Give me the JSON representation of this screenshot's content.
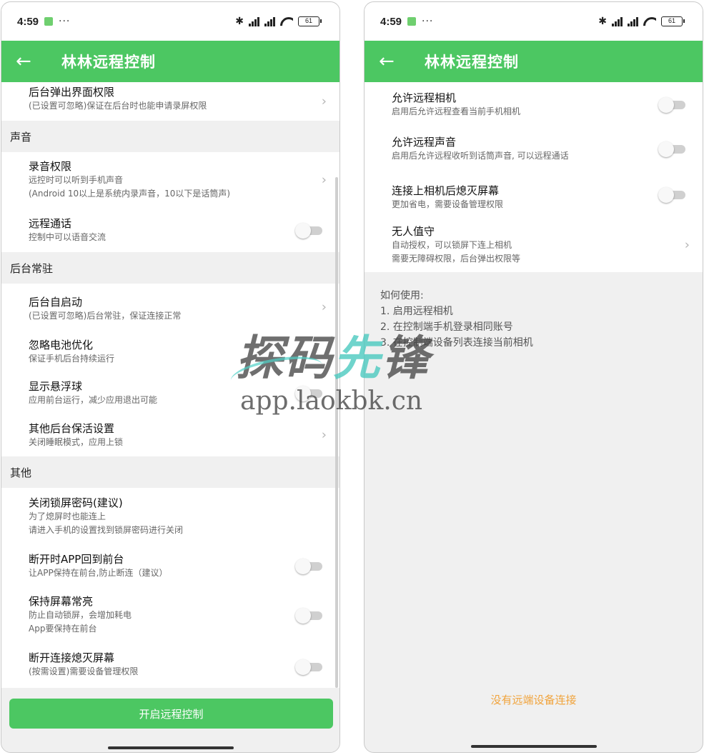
{
  "status": {
    "time": "4:59",
    "dots": "···",
    "battery": "61"
  },
  "app": {
    "title": "林林远程控制"
  },
  "left": {
    "top_item": {
      "title": "后台弹出界面权限",
      "sub": "(已设置可忽略)保证在后台时也能申请录屏权限"
    },
    "sections": [
      {
        "header": "声音",
        "items": [
          {
            "title": "录音权限",
            "sub": [
              "远控时可以听到手机声音",
              "(Android 10以上是系统内录声音，10以下是话筒声)"
            ],
            "control": "chevron"
          },
          {
            "title": "远程通话",
            "sub": [
              "控制中可以语音交流"
            ],
            "control": "toggle"
          }
        ]
      },
      {
        "header": "后台常驻",
        "items": [
          {
            "title": "后台自启动",
            "sub": [
              "(已设置可忽略)后台常驻，保证连接正常"
            ],
            "control": "chevron"
          },
          {
            "title": "忽略电池优化",
            "sub": [
              "保证手机后台持续运行"
            ],
            "control": "none"
          },
          {
            "title": "显示悬浮球",
            "sub": [
              "应用前台运行，减少应用退出可能"
            ],
            "control": "toggle"
          },
          {
            "title": "其他后台保活设置",
            "sub": [
              "关闭睡眠模式，应用上锁"
            ],
            "control": "chevron"
          }
        ]
      },
      {
        "header": "其他",
        "items": [
          {
            "title": "关闭锁屏密码(建议)",
            "sub": [
              "为了熄屏时也能连上",
              "请进入手机的设置找到锁屏密码进行关闭"
            ],
            "control": "none"
          },
          {
            "title": "断开时APP回到前台",
            "sub": [
              "让APP保持在前台,防止断连（建议）"
            ],
            "control": "toggle"
          },
          {
            "title": "保持屏幕常亮",
            "sub": [
              "防止自动锁屏，会增加耗电",
              "App要保持在前台"
            ],
            "control": "toggle"
          },
          {
            "title": "断开连接熄灭屏幕",
            "sub": [
              "(按需设置)需要设备管理权限"
            ],
            "control": "toggle"
          }
        ]
      }
    ],
    "button_label": "开启远程控制"
  },
  "right": {
    "items": [
      {
        "title": "允许远程相机",
        "sub": [
          "启用后允许远程查看当前手机相机"
        ],
        "control": "toggle"
      },
      {
        "title": "允许远程声音",
        "sub": [
          "启用后允许远程收听到话筒声音, 可以远程通话"
        ],
        "control": "toggle"
      },
      {
        "title": "连接上相机后熄灭屏幕",
        "sub": [
          "更加省电，需要设备管理权限"
        ],
        "control": "toggle"
      },
      {
        "title": "无人值守",
        "sub": [
          "自动授权，可以锁屏下连上相机",
          "需要无障碍权限，后台弹出权限等"
        ],
        "control": "chevron"
      }
    ],
    "howto": [
      "如何使用:",
      "1. 启用远程相机",
      "2. 在控制端手机登录相同账号",
      "3. 在控制端设备列表连接当前相机"
    ],
    "no_device": "没有远端设备连接"
  },
  "watermark": {
    "logo_part1": "探码",
    "logo_part2": "先",
    "logo_part3": "锋",
    "url": "app.laokbk.cn"
  },
  "colors": {
    "primary": "#4cc762",
    "accent_text": "#f1a33b",
    "background": "#f0f0f0"
  }
}
